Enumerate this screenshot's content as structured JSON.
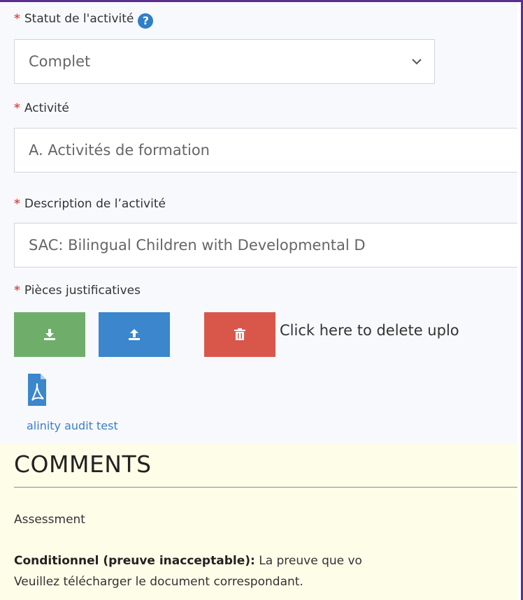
{
  "form": {
    "status": {
      "required": "*",
      "label": "Statut de l'activité",
      "help_icon": "?",
      "value": "Complet"
    },
    "activity": {
      "required": "*",
      "label": "Activité",
      "value": "A. Activités de formation"
    },
    "description": {
      "required": "*",
      "label": "Description de l’activité",
      "value": "SAC: Bilingual Children with Developmental D"
    },
    "documents": {
      "required": "*",
      "label": "Pièces justificatives",
      "delete_hint": "Click here to delete uplo",
      "file_name": "alinity audit test"
    }
  },
  "comments": {
    "title": "COMMENTS",
    "assessment_label": "Assessment",
    "assessment_status": "Conditionnel (preuve inacceptable):",
    "assessment_text_1": " La preuve que vo",
    "assessment_text_2": "Veuillez télécharger le document correspondant."
  },
  "colors": {
    "required": "#d9534f",
    "download_button": "#6fae6a",
    "upload_button": "#3b86cc",
    "delete_button": "#d9574a",
    "link": "#3b7dc9",
    "comments_bg": "#fefde8"
  },
  "icons": {
    "help": "help-icon",
    "chevron": "chevron-down-icon",
    "download": "download-icon",
    "upload": "upload-icon",
    "delete": "trash-icon",
    "file": "pdf-file-icon"
  }
}
